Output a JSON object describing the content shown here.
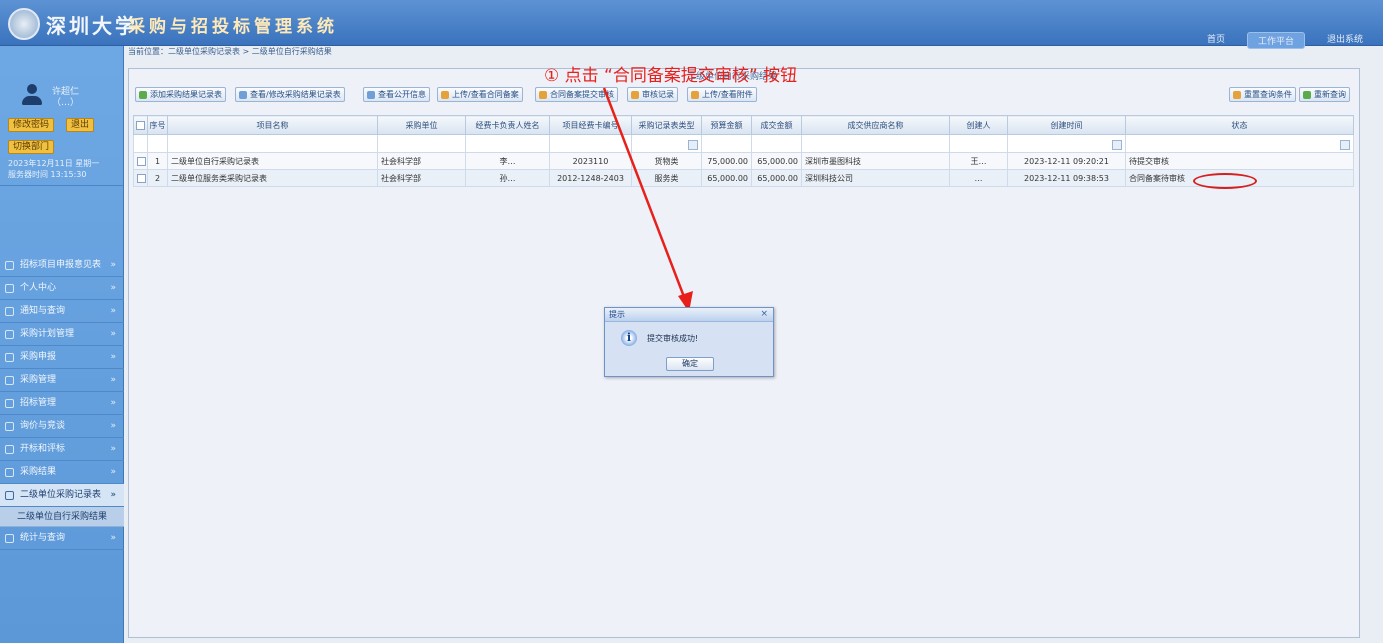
{
  "header": {
    "university": "深圳大学",
    "system": "采购与招投标管理系统",
    "nav": [
      "首页",
      "工作平台",
      "退出系统"
    ]
  },
  "breadcrumb": "当前位置：二级单位采购记录表 > 二级单位自行采购结果",
  "user": {
    "name": "许超仁",
    "role": "（…）",
    "btn_change_pwd": "修改密码",
    "btn_logout": "退出",
    "btn_switch": "切换部门",
    "date_line1": "2023年12月11日 星期一",
    "date_line2": "服务器时间 13:15:30"
  },
  "menu": [
    "招标项目申报意见表",
    "个人中心",
    "通知与查询",
    "采购计划管理",
    "采购申报",
    "采购管理",
    "招标管理",
    "询价与竞谈",
    "开标和评标",
    "采购结果",
    "二级单位采购记录表",
    "统计与查询"
  ],
  "submenu": [
    "二级单位自行采购结果"
  ],
  "panel_title": "二级单位自行采购结果",
  "toolbar": {
    "add": "添加采购结果记录表",
    "view_edit": "查看/修改采购结果记录表",
    "view_public": "查看公开信息",
    "upload_contract": "上传/查看合同备案",
    "submit_review": "合同备案提交审核",
    "review_record": "审核记录",
    "upload_attach": "上传/查看附件",
    "reset": "重置查询条件",
    "refresh": "重新查询"
  },
  "table": {
    "headers": [
      "序号",
      "项目名称",
      "采购单位",
      "经费卡负责人姓名",
      "项目经费卡编号",
      "采购记录表类型",
      "预算金额",
      "成交金额",
      "成交供应商名称",
      "创建人",
      "创建时间",
      "状态"
    ],
    "rows": [
      {
        "idx": "1",
        "name": "二级单位自行采购记录表",
        "unit": "社会科学部",
        "leader": "李…",
        "card": "2023110",
        "type": "货物类",
        "budget": "75,000.00",
        "amount": "65,000.00",
        "supplier": "深圳市墨图科技",
        "creator": "王…",
        "time": "2023-12-11 09:20:21",
        "status": "待提交审核"
      },
      {
        "idx": "2",
        "name": "二级单位服务类采购记录表",
        "unit": "社会科学部",
        "leader": "孙…",
        "card": "2012-1248-2403",
        "type": "服务类",
        "budget": "65,000.00",
        "amount": "65,000.00",
        "supplier": "深圳科技公司",
        "creator": "…",
        "time": "2023-12-11 09:38:53",
        "status": "合同备案待审核"
      }
    ]
  },
  "annotation": "① 点击 “合同备案提交审核” 按钮",
  "dialog": {
    "title": "提示",
    "close": "×",
    "icon": "i",
    "message": "提交审核成功!",
    "ok": "确定"
  },
  "colors": {
    "annotation": "#e8201c",
    "header": "#3a73bd",
    "sidebar": "#6ea8e4"
  }
}
